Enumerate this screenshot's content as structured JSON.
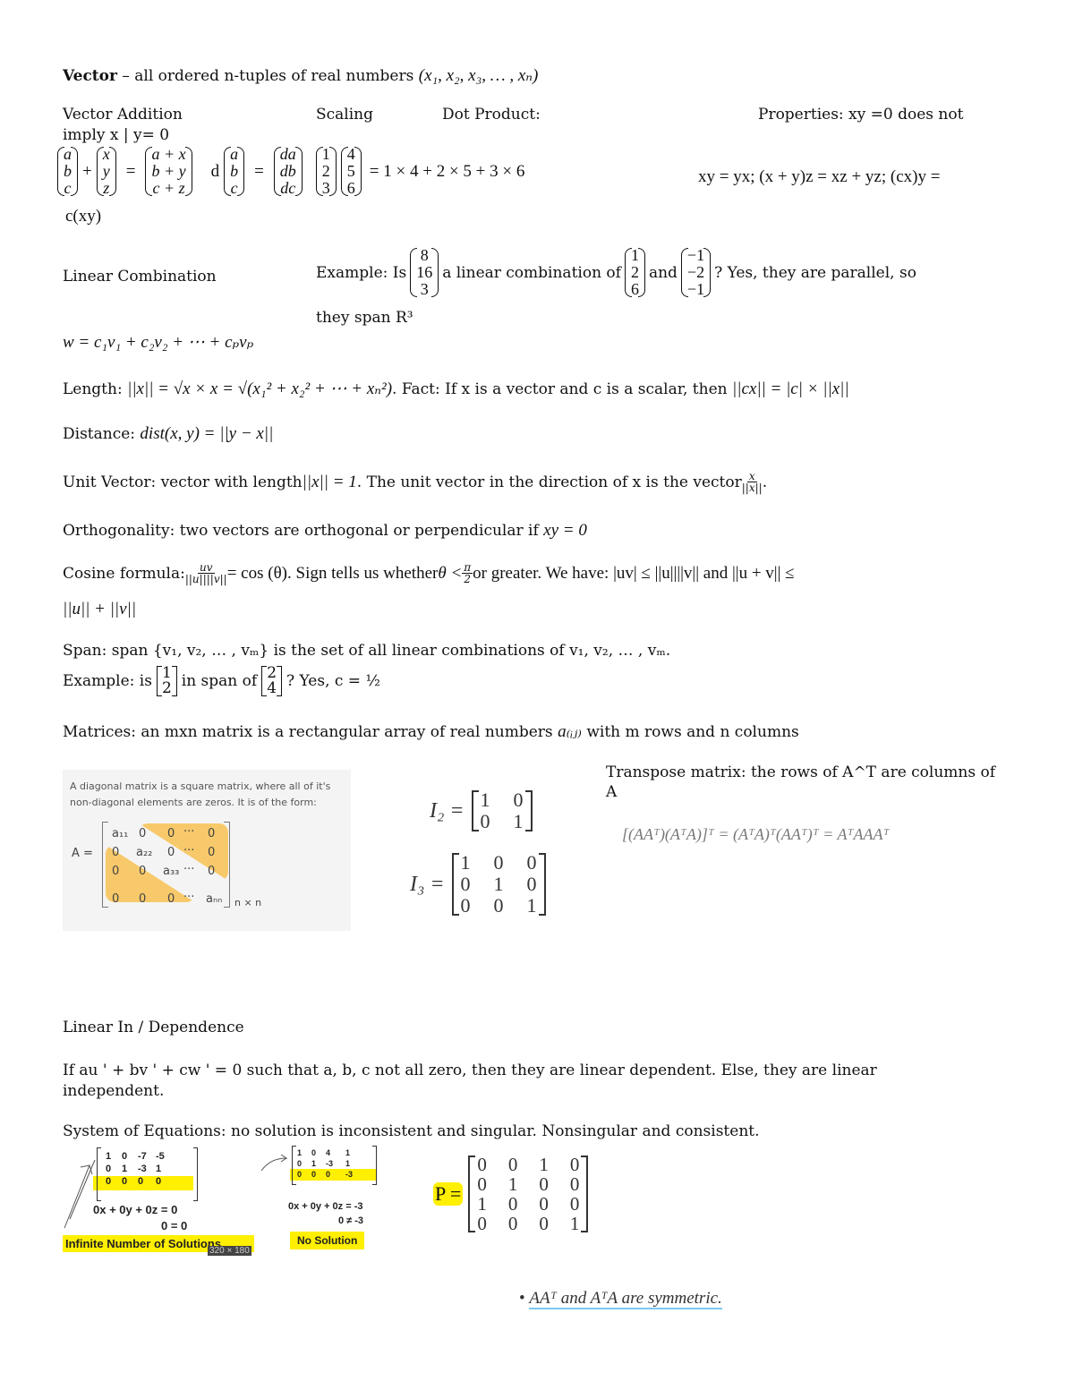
{
  "vector": {
    "title": "Vector",
    "definition": " – all ordered n-tuples of real numbers ",
    "tuple": "(x₁, x₂, x₃, … , xₙ)"
  },
  "headers": {
    "vector_addition": "Vector Addition",
    "scaling": "Scaling",
    "dot_product": "Dot Product:",
    "properties": "Properties: xy =0 does not",
    "imply": "imply x | y= 0"
  },
  "vector_addition": {
    "left": [
      "a",
      "b",
      "c"
    ],
    "right": [
      "x",
      "y",
      "z"
    ],
    "result": [
      "a + x",
      "b + y",
      "c + z"
    ],
    "plus": "+",
    "equals": "="
  },
  "scaling": {
    "scalar": "d",
    "vec": [
      "a",
      "b",
      "c"
    ],
    "result": [
      "da",
      "db",
      "dc"
    ],
    "equals": "="
  },
  "dot_product": {
    "left": [
      "1",
      "2",
      "3"
    ],
    "right": [
      "4",
      "5",
      "6"
    ],
    "expansion": "= 1 × 4 + 2 × 5 + 3 × 6"
  },
  "properties_formula": "xy =  yx;  (x + y)z =  xz  +  yz; (cx)y  =",
  "properties_tail": "c(xy)",
  "linear_combination": {
    "label": "Linear Combination",
    "example_prefix": "Example: Is",
    "vec1": [
      "8",
      "16",
      "3"
    ],
    "mid": "a linear combination of",
    "vec2": [
      "1",
      "2",
      "6"
    ],
    "and": "and",
    "vec3": [
      "−1",
      "−2",
      "−1"
    ],
    "answer": "? Yes, they are parallel, so",
    "line2": "they span R³",
    "formula": "w = c₁v₁ + c₂v₂ + ⋯ + cₚvₚ"
  },
  "length": {
    "label": "Length: ",
    "formula": "||x|| = √x × x = √(x₁² + x₂² + ⋯ + xₙ²)",
    "fact": ". Fact: If x is a vector and c is a scalar, then ",
    "fact_formula": "||cx|| = |c| × ||x||"
  },
  "distance": {
    "label": "Distance: ",
    "formula": "dist(x, y) = ||y − x||"
  },
  "unit_vector": {
    "label": "Unit Vector: vector with length ",
    "formula": "||x|| = 1",
    "rest": ". The unit vector in the direction of x is the vector ",
    "frac_num": "x",
    "frac_den": "||x||",
    "end": "."
  },
  "orthogonality": {
    "text": "Orthogonality: two vectors are orthogonal or perpendicular if ",
    "formula": "xy = 0"
  },
  "cosine": {
    "label": "Cosine formula: ",
    "frac_num": "uv",
    "frac_den": "||u||||v||",
    "eq": " = cos (θ). Sign tells us whether ",
    "theta": "θ < ",
    "pi_num": "π",
    "pi_den": "2",
    "rest": " or greater. We have: |uv| ≤ ||u||||v|| and ||u + v|| ≤",
    "line2": "||u|| + ||v||"
  },
  "span": {
    "text": "Span: span {v₁, v₂, … , vₘ} is the set of all linear combinations of v₁, v₂, … , vₘ.",
    "example_prefix": "Example: is",
    "vec1": [
      "1",
      "2"
    ],
    "mid": "in span of",
    "vec2": [
      "2",
      "4"
    ],
    "answer": "? Yes, c = ½"
  },
  "matrices": {
    "text": "Matrices: an mxn matrix is a rectangular array of real numbers ",
    "aij": "a₍ᵢⱼ₎",
    "rest": " with m rows and n columns"
  },
  "diagonal_image": {
    "caption": "A diagonal matrix is a square matrix, where all of it's non-diagonal elements are zeros. It is of the form:",
    "lhs": "A =",
    "diag": [
      "a₁₁",
      "a₂₂",
      "a₃₃",
      "aₙₙ"
    ],
    "size": "n × n",
    "zero": "0",
    "dots": "···"
  },
  "identity": {
    "i2_label": "I₂ =",
    "i2": [
      [
        "1",
        "0"
      ],
      [
        "0",
        "1"
      ]
    ],
    "i3_label": "I₃ =",
    "i3": [
      [
        "1",
        "0",
        "0"
      ],
      [
        "0",
        "1",
        "0"
      ],
      [
        "0",
        "0",
        "1"
      ]
    ]
  },
  "transpose": {
    "text": "Transpose matrix: the rows of A^T are columns of A",
    "formula": "[(AAᵀ)(AᵀA)]ᵀ = (AᵀA)ᵀ(AAᵀ)ᵀ = AᵀAAAᵀ"
  },
  "dependence": {
    "label": "Linear In / Dependence",
    "text": "If au ' + bv ' + cw ' = 0 such that a, b, c not all zero, then they are linear dependent. Else, they are linear",
    "text2": "independent."
  },
  "system": {
    "text": "System of Equations: no solution is inconsistent and singular. Nonsingular and consistent."
  },
  "infinite_image": {
    "rows": [
      [
        "1",
        "0",
        "-7",
        "-5"
      ],
      [
        "0",
        "1",
        "-3",
        "1"
      ],
      [
        "0",
        "0",
        "0",
        "0"
      ]
    ],
    "eq1": "0x + 0y + 0z = 0",
    "eq2": "0 = 0",
    "label": "Infinite Number of Solutions",
    "size_badge": "320 × 180"
  },
  "nosolution_image": {
    "rows": [
      [
        "1",
        "0",
        "4",
        "1"
      ],
      [
        "0",
        "1",
        "-3",
        "1"
      ],
      [
        "0",
        "0",
        "0",
        "-3"
      ]
    ],
    "eq1": "0x + 0y + 0z = -3",
    "eq2": "0 ≠ -3",
    "label": "No Solution"
  },
  "permutation": {
    "label": "P =",
    "rows": [
      [
        "0",
        "0",
        "1",
        "0"
      ],
      [
        "0",
        "1",
        "0",
        "0"
      ],
      [
        "1",
        "0",
        "0",
        "0"
      ],
      [
        "0",
        "0",
        "0",
        "1"
      ]
    ]
  },
  "symmetric_note": {
    "bullet": "•",
    "text": "AAᵀ and AᵀA are symmetric."
  }
}
